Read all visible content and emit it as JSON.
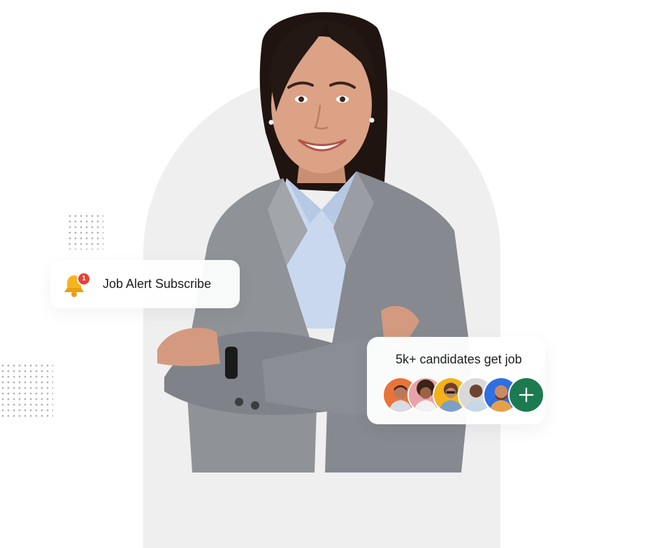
{
  "job_alert": {
    "label": "Job Alert Subscribe",
    "badge_count": "1",
    "icon": "bell-icon"
  },
  "candidates": {
    "title": "5k+ candidates get job",
    "avatars": [
      {
        "name": "candidate-avatar-1",
        "bg": "#e8743b"
      },
      {
        "name": "candidate-avatar-2",
        "bg": "#e8a3a8"
      },
      {
        "name": "candidate-avatar-3",
        "bg": "#f3b21a"
      },
      {
        "name": "candidate-avatar-4",
        "bg": "#d9d9d9"
      },
      {
        "name": "candidate-avatar-5",
        "bg": "#2f6fe0"
      }
    ],
    "add_icon": "plus-icon"
  },
  "colors": {
    "accent_green": "#1c7a50",
    "badge_red": "#e74137",
    "bell_yellow": "#f6b51e",
    "backdrop_grey": "#efefef"
  }
}
